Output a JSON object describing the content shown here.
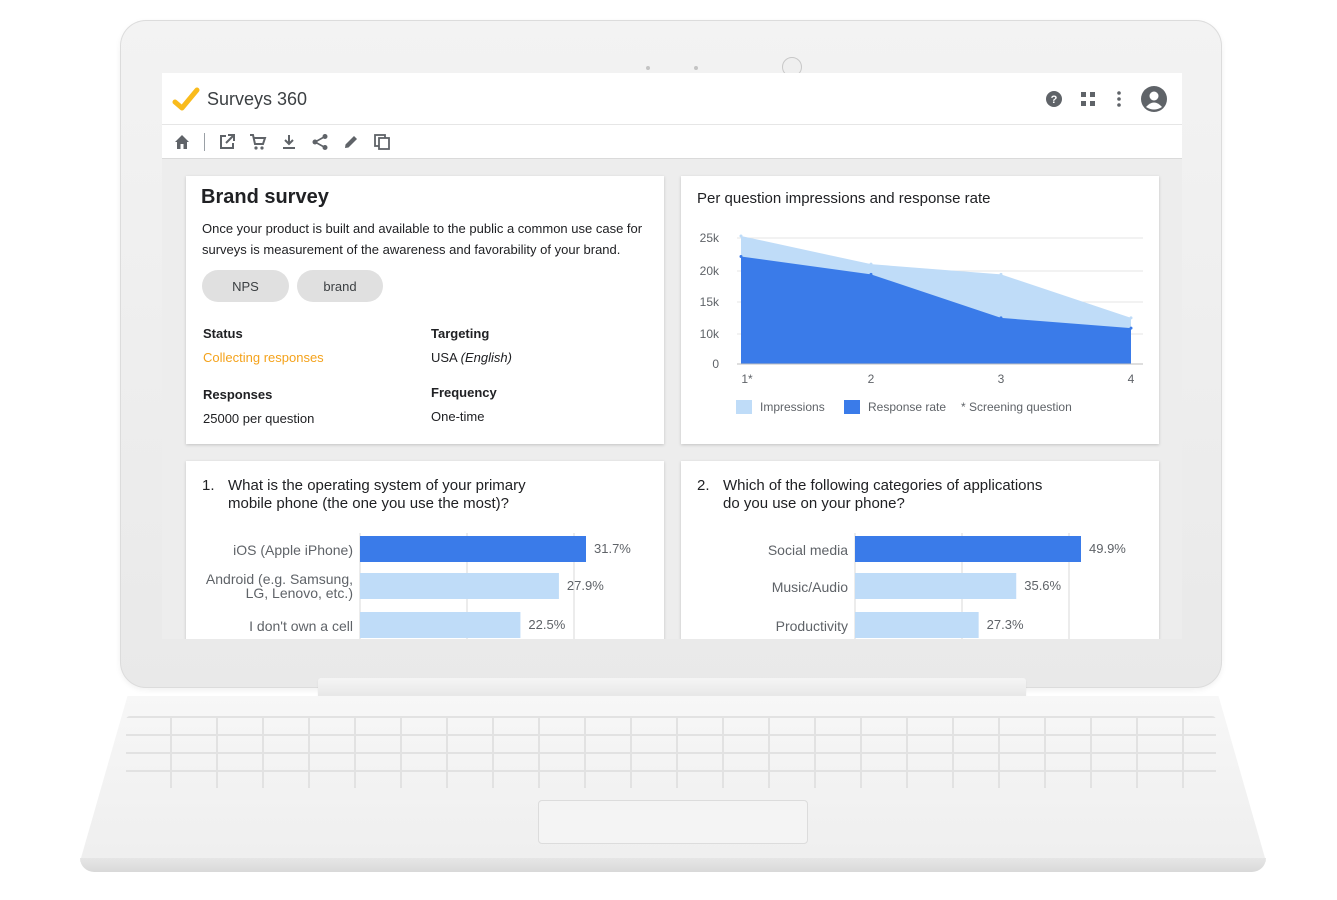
{
  "app": {
    "title": "Surveys 360"
  },
  "icons": {
    "top": [
      "help-icon",
      "apps-grid-icon",
      "more-vert-icon",
      "account-icon"
    ],
    "toolbar": [
      "home-icon",
      "open-in-new-icon",
      "cart-icon",
      "download-icon",
      "share-icon",
      "edit-icon",
      "copy-icon"
    ]
  },
  "colors": {
    "accent_orange": "#f4a21b",
    "logo_yellow": "#f9bb1c",
    "blue_dark": "#3a7be9",
    "blue_light": "#bfdcf8"
  },
  "survey": {
    "title": "Brand survey",
    "description": "Once your product is built and available to the public a common use case for surveys is measurement of the awareness and favorability of your brand.",
    "tags": [
      "NPS",
      "brand"
    ],
    "status_label": "Status",
    "status_value": "Collecting responses",
    "targeting_label": "Targeting",
    "targeting_value": "USA",
    "targeting_lang": "(English)",
    "responses_label": "Responses",
    "responses_value": "25000 per question",
    "frequency_label": "Frequency",
    "frequency_value": "One-time"
  },
  "chart_data": [
    {
      "type": "area",
      "title": "Per question impressions and response rate",
      "x": [
        "1*",
        "2",
        "3",
        "4"
      ],
      "y_ticks": [
        "25k",
        "20k",
        "15k",
        "10k",
        "0"
      ],
      "ylim": [
        0,
        25000
      ],
      "grid": true,
      "series": [
        {
          "name": "Impressions",
          "color": "#bfdcf8",
          "values": [
            25000,
            19500,
            17500,
            9000
          ]
        },
        {
          "name": "Response rate",
          "color": "#3a7be9",
          "values": [
            21000,
            17500,
            9000,
            7000
          ]
        }
      ],
      "legend_note": "* Screening question",
      "legend_position": "bottom"
    },
    {
      "type": "bar",
      "orientation": "horizontal",
      "question_number": "1.",
      "question": "What is the operating system of your primary mobile phone (the one you use the most)?",
      "categories": [
        [
          "iOS (Apple iPhone)"
        ],
        [
          "Android (e.g. Samsung,",
          "LG, Lenovo, etc.)"
        ],
        [
          "I don't own a cell"
        ]
      ],
      "values": [
        31.7,
        27.9,
        22.5
      ],
      "labels": [
        "31.7%",
        "27.9%",
        "22.5%"
      ],
      "highlight_index": 0,
      "xlim": [
        0,
        40
      ]
    },
    {
      "type": "bar",
      "orientation": "horizontal",
      "question_number": "2.",
      "question": "Which of the following categories of applications do you use on your phone?",
      "categories": [
        [
          "Social media"
        ],
        [
          "Music/Audio"
        ],
        [
          "Productivity"
        ]
      ],
      "values": [
        49.9,
        35.6,
        27.3
      ],
      "labels": [
        "49.9%",
        "35.6%",
        "27.3%"
      ],
      "highlight_index": 0,
      "xlim": [
        0,
        60
      ]
    }
  ]
}
